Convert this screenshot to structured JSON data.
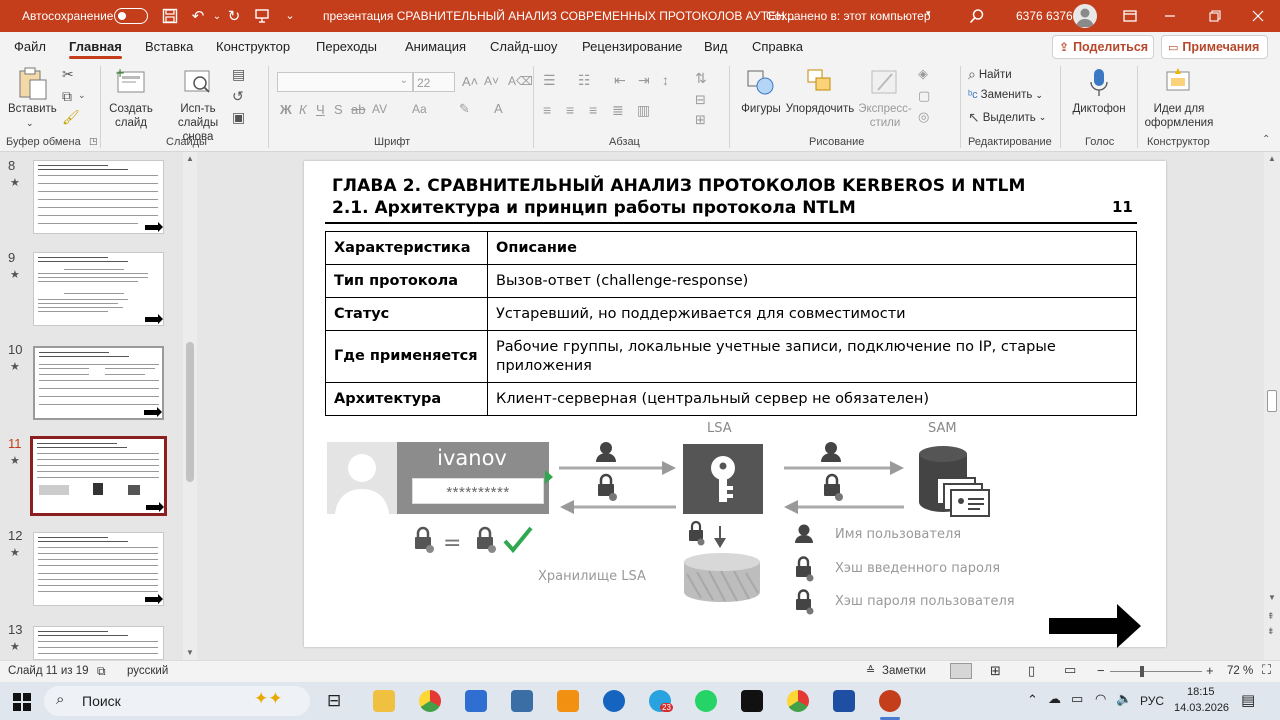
{
  "titlebar": {
    "autosave_label": "Автосохранение",
    "doc_title": "презентация СРАВНИТЕЛЬНЫЙ АНАЛИЗ СОВРЕМЕННЫХ ПРОТОКОЛОВ АУТЕН...",
    "save_status": "Сохранено в: этот компьютер",
    "user_name": "6376 6376"
  },
  "menu": {
    "items": [
      "Файл",
      "Главная",
      "Вставка",
      "Конструктор",
      "Переходы",
      "Анимация",
      "Слайд-шоу",
      "Рецензирование",
      "Вид",
      "Справка"
    ],
    "active": "Главная",
    "share_label": "Поделиться",
    "comments_label": "Примечания"
  },
  "ribbon": {
    "paste_label": "Вставить",
    "create_slide_label": "Создать слайд",
    "reuse_slides_label": "Исп-ть слайды снова",
    "font_size_value": "22",
    "shapes_label": "Фигуры",
    "arrange_label": "Упорядочить",
    "quick_styles_label": "Экспресс-стили",
    "find_label": "Найти",
    "replace_label": "Заменить",
    "select_label": "Выделить",
    "dictate_label": "Диктофон",
    "designer_label": "Идеи для оформления",
    "groups": {
      "clipboard": "Буфер обмена",
      "slides": "Слайды",
      "font": "Шрифт",
      "paragraph": "Абзац",
      "drawing": "Рисование",
      "editing": "Редактирование",
      "voice": "Голос",
      "designer": "Конструктор"
    }
  },
  "thumbnails": [
    {
      "num": "8"
    },
    {
      "num": "9"
    },
    {
      "num": "10"
    },
    {
      "num": "11"
    },
    {
      "num": "12"
    },
    {
      "num": "13"
    }
  ],
  "slide": {
    "heading1": "ГЛАВА 2. СРАВНИТЕЛЬНЫЙ АНАЛИЗ ПРОТОКОЛОВ KERBEROS И NTLM",
    "heading2": "2.1. Архитектура и принцип работы протокола NTLM",
    "page_number": "11",
    "table": {
      "headers": [
        "Характеристика",
        "Описание"
      ],
      "rows": [
        [
          "Тип протокола",
          "Вызов-ответ (challenge-response)"
        ],
        [
          "Статус",
          "Устаревший, но поддерживается для совместимости"
        ],
        [
          "Где применяется",
          "Рабочие группы, локальные учетные записи, подключение по IP, старые приложения"
        ],
        [
          "Архитектура",
          "Клиент-серверная (центральный сервер не обязателен)"
        ]
      ]
    },
    "diagram": {
      "username": "ivanov",
      "password_mask": "**********",
      "lsa_label": "LSA",
      "sam_label": "SAM",
      "lsa_storage_label": "Хранилище LSA",
      "legend": [
        "Имя пользователя",
        "Хэш введенного пароля",
        "Хэш пароля пользователя"
      ]
    }
  },
  "statusbar": {
    "slide_info": "Слайд 11 из 19",
    "language": "русский",
    "notes_label": "Заметки",
    "zoom": "72 %"
  },
  "taskbar": {
    "search_label": "Поиск",
    "language": "РУС",
    "time": "18:15",
    "date": "14.03.2026",
    "telegram_badge": "23"
  },
  "colors": {
    "accent": "#c43e1c",
    "selected_thumb": "#8b1e1e"
  }
}
